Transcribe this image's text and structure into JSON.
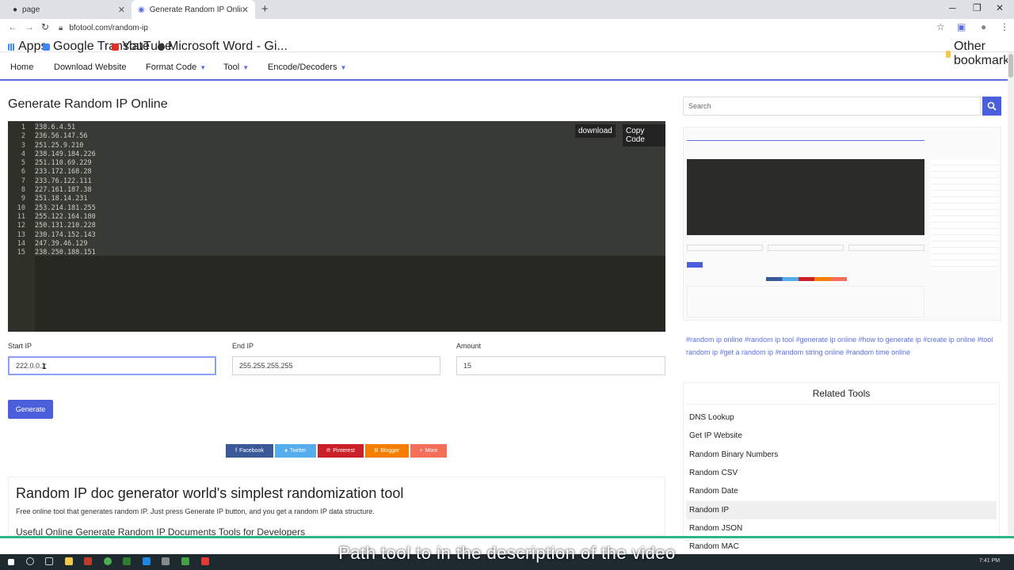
{
  "browser": {
    "tabs": [
      {
        "label": "page"
      },
      {
        "label": "Generate Random IP Online - bfo"
      }
    ],
    "url": "bfotool.com/random-ip",
    "bookmarks": [
      "Apps",
      "Google Translate",
      "YouTube",
      "Microsoft Word - Gi...",
      "Other bookmarks"
    ]
  },
  "nav": {
    "items": [
      "Home",
      "Download Website",
      "Format Code",
      "Tool",
      "Encode/Decoders"
    ]
  },
  "main": {
    "title": "Generate Random IP Online",
    "download_label": "download",
    "copy_label": "Copy Code",
    "lines": [
      "238.6.4.51",
      "236.56.147.56",
      "251.25.9.210",
      "238.149.184.226",
      "251.110.69.229",
      "233.172.168.28",
      "233.76.122.111",
      "227.161.187.38",
      "251.18.14.231",
      "253.214.181.255",
      "255.122.164.180",
      "250.131.210.228",
      "230.174.152.143",
      "247.39.46.129",
      "238.250.188.151"
    ],
    "start_ip_label": "Start IP",
    "start_ip_value": "222.0.0.1",
    "end_ip_label": "End IP",
    "end_ip_value": "255.255.255.255",
    "amount_label": "Amount",
    "amount_value": "15",
    "generate_label": "Generate",
    "share": [
      {
        "label": "Facebook",
        "color": "#3b5998"
      },
      {
        "label": "Twitter",
        "color": "#55acee"
      },
      {
        "label": "Pinterest",
        "color": "#cb2027"
      },
      {
        "label": "Blogger",
        "color": "#f57d00"
      },
      {
        "label": "More",
        "color": "#f36f5a"
      }
    ],
    "desc_title": "Random IP doc generator world's simplest randomization tool",
    "desc_text": "Free online tool that generates random IP. Just press Generate IP button, and you get a random IP data structure.",
    "desc_sub": "Useful Online Generate Random IP Documents Tools for Developers"
  },
  "sidebar": {
    "search_placeholder": "Search",
    "tags": "#random ip online  #random ip tool  #generate ip online  #how to generate ip  #create ip online  #tool random ip  #get a random ip  #random string online  #random time online",
    "related_title": "Related Tools",
    "related": [
      "DNS Lookup",
      "Get IP Website",
      "Random Binary Numbers",
      "Random CSV",
      "Random Date",
      "Random IP",
      "Random JSON",
      "Random MAC"
    ],
    "active_related": "Random IP"
  },
  "overlay": {
    "caption": "Path tool to in the description of the video",
    "clock": "7:41 PM"
  },
  "colors": {
    "accent": "#4b5fdc",
    "editor_bg": "#272822",
    "caption_bar": "#2db58a"
  }
}
